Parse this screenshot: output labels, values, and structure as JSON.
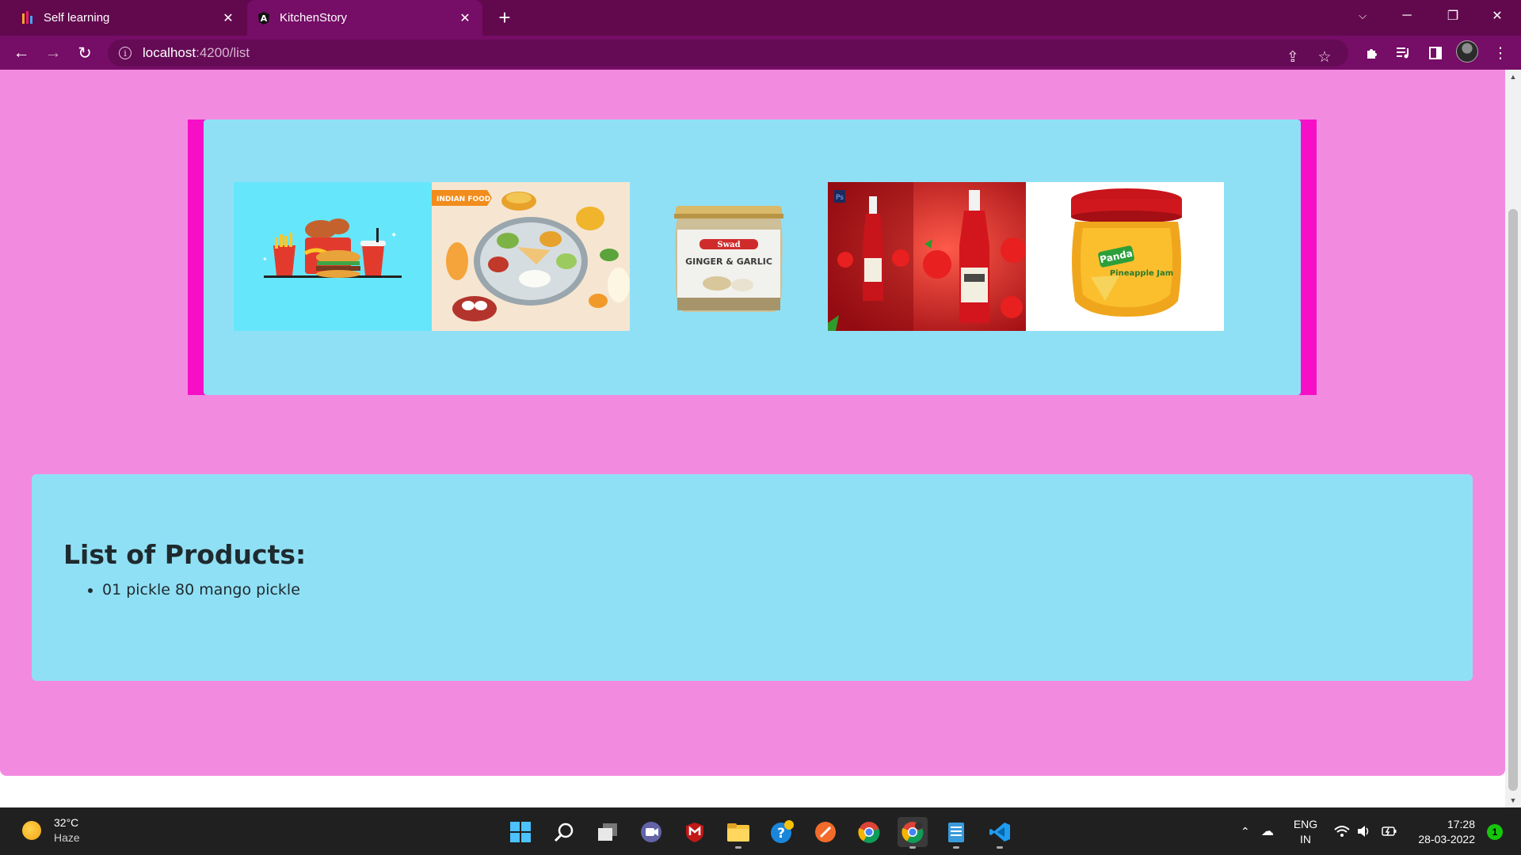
{
  "browser": {
    "tabs": [
      {
        "title": "Self learning",
        "active": false,
        "favicon": "bar-chart-icon"
      },
      {
        "title": "KitchenStory",
        "active": true,
        "favicon": "angular-icon"
      }
    ],
    "url_host": "localhost",
    "url_path": ":4200/list"
  },
  "page": {
    "background": "#f28be0",
    "carousel": {
      "frame_color": "#f70fc7",
      "panel_color": "#90e0f5",
      "slides": [
        {
          "alt": "fast food"
        },
        {
          "alt": "indian food thali",
          "badge": "INDIAN FOOD"
        },
        {
          "alt": "ginger garlic jar",
          "label_top": "Swad",
          "label_main": "GINGER & GARLIC"
        },
        {
          "alt": "tomato ketchup"
        },
        {
          "alt": "pineapple jam jar",
          "label_brand": "Panda",
          "label_main": "Pineapple Jam"
        }
      ]
    },
    "products": {
      "heading": "List of Products:",
      "items": [
        "01 pickle 80 mango pickle"
      ]
    }
  },
  "taskbar": {
    "weather": {
      "temp": "32°C",
      "condition": "Haze"
    },
    "apps": [
      "windows-start-icon",
      "search-icon",
      "task-view-icon",
      "teams-chat-icon",
      "mcafee-icon",
      "file-explorer-icon",
      "help-icon",
      "pen-app-icon",
      "chrome-icon",
      "chrome-dev-icon",
      "notepad-icon",
      "vscode-icon"
    ],
    "language": {
      "line1": "ENG",
      "line2": "IN"
    },
    "clock": {
      "time": "17:28",
      "date": "28-03-2022"
    },
    "notifications": "1"
  }
}
